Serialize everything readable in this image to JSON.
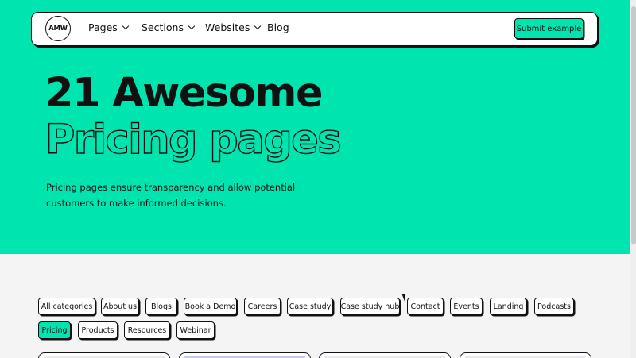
{
  "header": {
    "logo_text": "AMW",
    "nav": [
      {
        "label": "Pages",
        "has_dropdown": true
      },
      {
        "label": "Sections",
        "has_dropdown": true
      },
      {
        "label": "Websites",
        "has_dropdown": true
      },
      {
        "label": "Blog",
        "has_dropdown": false
      }
    ],
    "submit_label": "Submit example"
  },
  "hero": {
    "title_line1": "21 Awesome",
    "title_line2": "Pricing pages",
    "description": "Pricing pages ensure transparency and allow potential customers to make informed decisions."
  },
  "filters": {
    "categories": [
      {
        "label": "All categories",
        "active": false
      },
      {
        "label": "About us",
        "active": false
      },
      {
        "label": "Blogs",
        "active": false
      },
      {
        "label": "Book a Demo",
        "active": false
      },
      {
        "label": "Careers",
        "active": false
      },
      {
        "label": "Case study",
        "active": false
      },
      {
        "label": "Case study hub",
        "active": false
      },
      {
        "label": "Contact",
        "active": false
      },
      {
        "label": "Events",
        "active": false
      },
      {
        "label": "Landing",
        "active": false
      },
      {
        "label": "Podcasts",
        "active": false
      },
      {
        "label": "Pricing",
        "active": true
      },
      {
        "label": "Products",
        "active": false
      },
      {
        "label": "Resources",
        "active": false
      },
      {
        "label": "Webinar",
        "active": false
      }
    ]
  },
  "colors": {
    "accent": "#00e5b0",
    "ink": "#111111",
    "page_bg": "#f4f4f4"
  },
  "icons": [
    "chevron-down-icon",
    "cursor-icon"
  ]
}
